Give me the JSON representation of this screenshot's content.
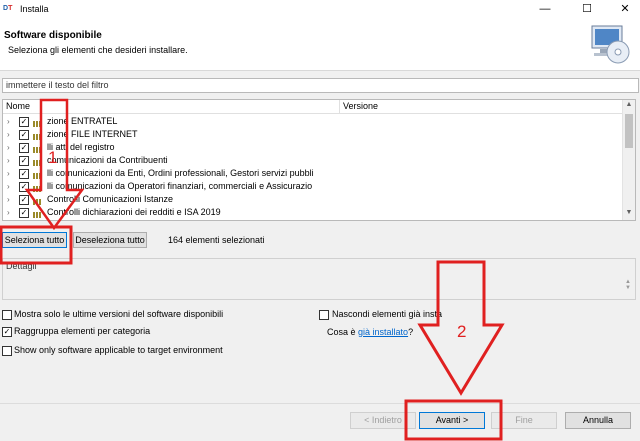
{
  "window": {
    "app_icon_d": "D",
    "app_icon_t": "T",
    "title": "Installa",
    "minimize": "—",
    "maximize": "☐",
    "close": "✕"
  },
  "header": {
    "title": "Software disponibile",
    "description": "Seleziona gli elementi che desideri installare."
  },
  "filter": {
    "value": "immettere il testo del filtro"
  },
  "tree": {
    "columns": [
      "Nome",
      "Versione"
    ],
    "rows": [
      {
        "label": "zione ENTRATEL",
        "checked": true
      },
      {
        "label": "zione FILE INTERNET",
        "checked": true
      },
      {
        "label": "lli atti del registro",
        "checked": true
      },
      {
        "label": "comunicazioni da Contribuenti",
        "checked": true
      },
      {
        "label": "lli comunicazioni da Enti, Ordini professionali, Gestori servizi pubbli",
        "checked": true
      },
      {
        "label": "lli comunicazioni da Operatori finanziari, commerciali e Assicurazio",
        "checked": true
      },
      {
        "label": "Controlli Comunicazioni Istanze",
        "checked": true
      },
      {
        "label": "Controlli dichiarazioni dei redditi e ISA 2019",
        "checked": true
      }
    ]
  },
  "selection": {
    "select_all": "Seleziona tutto",
    "deselect_all": "Deseleziona tutto",
    "count": "164 elementi selezionati"
  },
  "details": {
    "label": "Dettagli"
  },
  "options": {
    "latest_only": "Mostra solo le ultime versioni del software disponibili",
    "group_by_category": "Raggruppa elementi per categoria",
    "target_env": "Show only software applicable to target environment",
    "hide_installed": "Nascondi elementi già insta",
    "whats_installed_prefix": "Cosa è ",
    "whats_installed_link": "già installato",
    "whats_installed_suffix": "?"
  },
  "footer": {
    "back": "< Indietro",
    "next": "Avanti >",
    "finish": "Fine",
    "cancel": "Annulla"
  },
  "annotations": {
    "label_1": "1",
    "label_2": "2",
    "color": "#e02020"
  }
}
